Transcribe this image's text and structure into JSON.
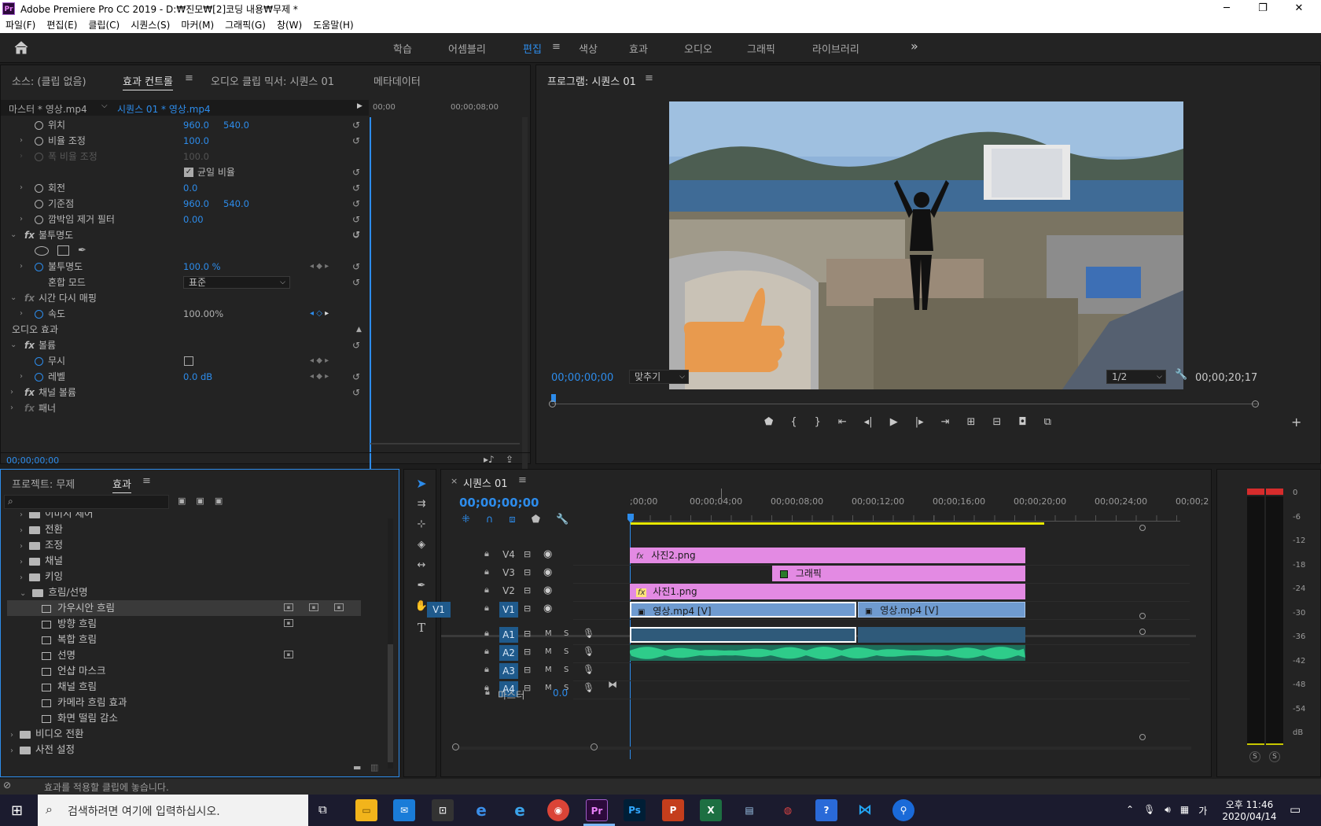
{
  "window": {
    "title": "Adobe Premiere Pro CC 2019 - D:₩진모₩[2]코딩 내용₩무제 *",
    "logo": "Pr",
    "min": "─",
    "max": "❐",
    "close": "✕"
  },
  "menu": [
    "파일(F)",
    "편집(E)",
    "클립(C)",
    "시퀀스(S)",
    "마커(M)",
    "그래픽(G)",
    "창(W)",
    "도움말(H)"
  ],
  "workspaces": [
    "학습",
    "어셈블리",
    "편집",
    "색상",
    "효과",
    "오디오",
    "그래픽",
    "라이브러리"
  ],
  "workspace_active": "편집",
  "workspace_more": "»",
  "source_panel": {
    "tabs": [
      "소스: (클립 없음)",
      "효과 컨트롤",
      "오디오 클립 믹서: 시퀀스 01",
      "메타데이터"
    ],
    "master": "마스터 * 영상.mp4",
    "sequence_clip": "시퀀스 01 * 영상.mp4",
    "ruler": [
      "00;00",
      "00;00;08;00"
    ],
    "rows": {
      "position": {
        "label": "위치",
        "x": "960.0",
        "y": "540.0"
      },
      "scale": {
        "label": "비율 조정",
        "value": "100.0"
      },
      "scale_width": {
        "label": "폭 비율 조정",
        "value": "100.0"
      },
      "uniform": {
        "label": "균일 비율"
      },
      "rotation": {
        "label": "회전",
        "value": "0.0"
      },
      "anchor": {
        "label": "기준점",
        "x": "960.0",
        "y": "540.0"
      },
      "flicker": {
        "label": "깜박임 제거 필터",
        "value": "0.00"
      },
      "opacity_group": {
        "label": "불투명도"
      },
      "opacity": {
        "label": "불투명도",
        "value": "100.0 %"
      },
      "blend": {
        "label": "혼합 모드",
        "value": "표준"
      },
      "time_remap": {
        "label": "시간 다시 매핑"
      },
      "speed": {
        "label": "속도",
        "value": "100.00%"
      },
      "audio_effects": {
        "label": "오디오 효과"
      },
      "volume_group": {
        "label": "볼륨"
      },
      "bypass": {
        "label": "무시"
      },
      "level": {
        "label": "레벨",
        "value": "0.0 dB"
      },
      "channel_volume": {
        "label": "채널 볼륨"
      },
      "panner": {
        "label": "패너"
      }
    },
    "timecode": "00;00;00;00"
  },
  "program": {
    "title": "프로그램: 시퀀스 01",
    "timecode": "00;00;00;00",
    "fit": "맞추기",
    "resolution": "1/2",
    "duration": "00;00;20;17"
  },
  "effects_panel": {
    "tabs": [
      "프로젝트: 무제",
      "효과"
    ],
    "items": [
      {
        "type": "folder",
        "label": "이미지 제어",
        "indent": 1
      },
      {
        "type": "folder",
        "label": "전환",
        "indent": 1
      },
      {
        "type": "folder",
        "label": "조정",
        "indent": 1
      },
      {
        "type": "folder",
        "label": "채널",
        "indent": 1
      },
      {
        "type": "folder",
        "label": "키잉",
        "indent": 1
      },
      {
        "type": "folder-open",
        "label": "흐림/선명",
        "indent": 1
      },
      {
        "type": "effect",
        "label": "가우시안 흐림",
        "indent": 2
      },
      {
        "type": "effect",
        "label": "방향 흐림",
        "indent": 2
      },
      {
        "type": "effect",
        "label": "복합 흐림",
        "indent": 2
      },
      {
        "type": "effect",
        "label": "선명",
        "indent": 2
      },
      {
        "type": "effect",
        "label": "언샵 마스크",
        "indent": 2
      },
      {
        "type": "effect",
        "label": "채널 흐림",
        "indent": 2
      },
      {
        "type": "effect",
        "label": "카메라 흐림 효과",
        "indent": 2
      },
      {
        "type": "effect",
        "label": "화면 떨림 감소",
        "indent": 2
      },
      {
        "type": "folder",
        "label": "비디오 전환",
        "indent": 0
      },
      {
        "type": "folder",
        "label": "사전 설정",
        "indent": 0
      }
    ]
  },
  "timeline": {
    "title": "시퀀스 01",
    "timecode": "00;00;00;00",
    "ruler": [
      ";00;00",
      "00;00;04;00",
      "00;00;08;00",
      "00;00;12;00",
      "00;00;16;00",
      "00;00;20;00",
      "00;00;24;00",
      "00;00;2"
    ],
    "video_tracks": [
      "V4",
      "V3",
      "V2",
      "V1"
    ],
    "audio_tracks": [
      "A1",
      "A2",
      "A3",
      "A4"
    ],
    "source_patch": "V1",
    "master": {
      "label": "마스터",
      "value": "0.0"
    },
    "clips": {
      "v4": "사진2.png",
      "v3": "그래픽",
      "v2": "사진1.png",
      "v1a": "영상.mp4 [V]",
      "v1b": "영상.mp4 [V]"
    }
  },
  "meter": {
    "scale": [
      "0",
      "-6",
      "-12",
      "-18",
      "-24",
      "-30",
      "-36",
      "-42",
      "-48",
      "-54",
      "dB"
    ],
    "solo": [
      "S",
      "S"
    ]
  },
  "status": "효과를 적용할 클립에 놓습니다.",
  "taskbar": {
    "search": "검색하려면 여기에 입력하십시오.",
    "time": "오후 11:46",
    "date": "2020/04/14",
    "lang": "가"
  },
  "colors": {
    "accent": "#2d8ceb",
    "pink_clip": "#e38ae3",
    "video_clip": "#6f9bd0",
    "audio_wave": "#2ecc8a"
  }
}
